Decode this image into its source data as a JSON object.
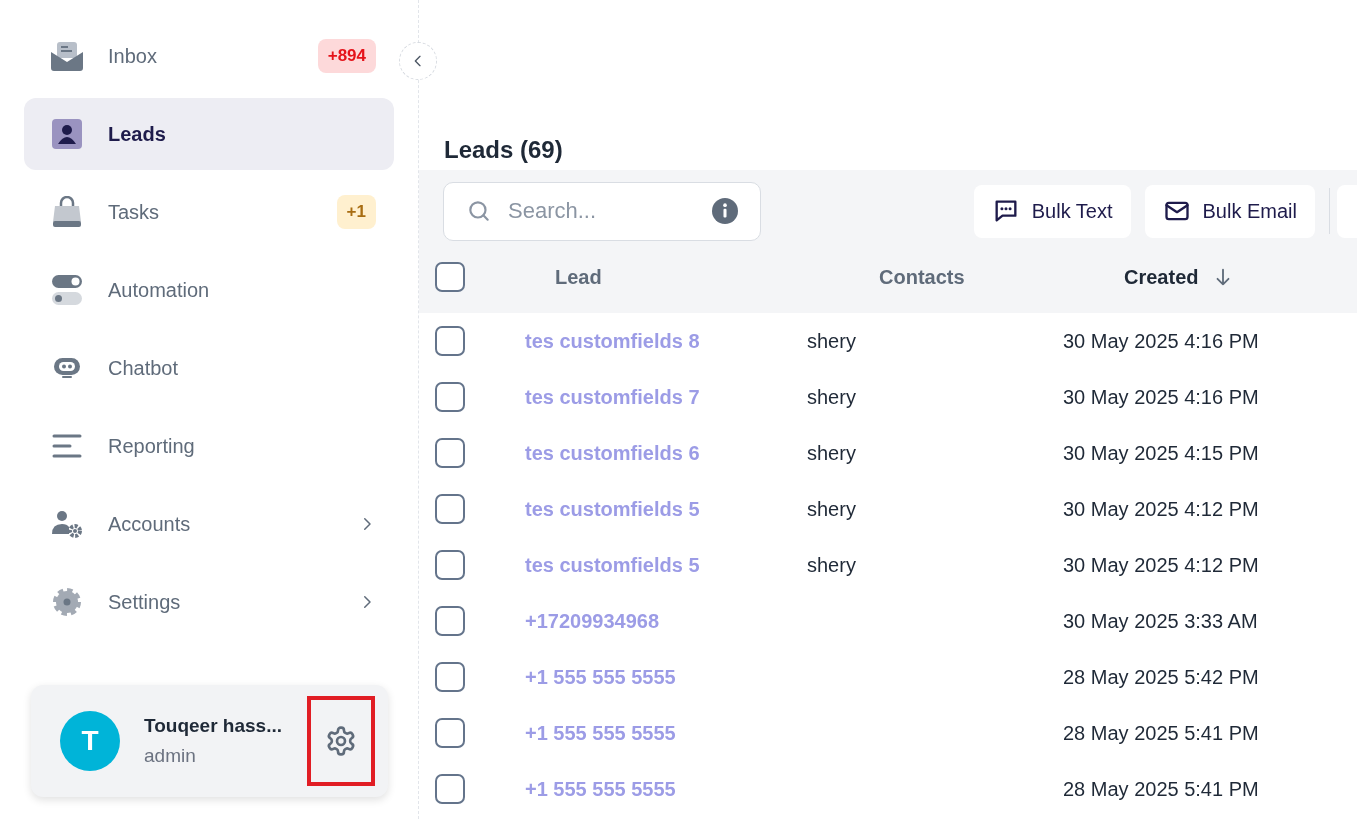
{
  "sidebar": {
    "items": [
      {
        "label": "Inbox",
        "kind": "inbox",
        "selected": false,
        "has_submenu": false,
        "badge": {
          "text": "+894",
          "kind": "danger"
        }
      },
      {
        "label": "Leads",
        "kind": "leads",
        "selected": true,
        "has_submenu": false
      },
      {
        "label": "Tasks",
        "kind": "tasks",
        "selected": false,
        "has_submenu": false,
        "badge": {
          "text": "+1",
          "kind": "warning"
        }
      },
      {
        "label": "Automation",
        "kind": "automation",
        "selected": false,
        "has_submenu": false
      },
      {
        "label": "Chatbot",
        "kind": "chatbot",
        "selected": false,
        "has_submenu": false
      },
      {
        "label": "Reporting",
        "kind": "reporting",
        "selected": false,
        "has_submenu": false
      },
      {
        "label": "Accounts",
        "kind": "accounts",
        "selected": false,
        "has_submenu": true
      },
      {
        "label": "Settings",
        "kind": "settings",
        "selected": false,
        "has_submenu": true
      }
    ],
    "profile": {
      "initial": "T",
      "name": "Touqeer hass...",
      "role": "admin",
      "settings_highlighted": true
    }
  },
  "page": {
    "title": "Leads (69)"
  },
  "toolbar": {
    "search": {
      "placeholder": "Search..."
    },
    "buttons": [
      {
        "label": "Bulk Text",
        "kind": "message"
      },
      {
        "label": "Bulk Email",
        "kind": "mail"
      }
    ]
  },
  "table": {
    "all_checked": false,
    "columns": [
      {
        "label": "Lead",
        "sorted": false
      },
      {
        "label": "Contacts",
        "sorted": false
      },
      {
        "label": "Created",
        "sorted": true
      }
    ],
    "rows": [
      {
        "lead": "tes customfields 8",
        "contacts": "shery",
        "created": "30 May 2025 4:16 PM",
        "checked": false
      },
      {
        "lead": "tes customfields 7",
        "contacts": "shery",
        "created": "30 May 2025 4:16 PM",
        "checked": false
      },
      {
        "lead": "tes customfields 6",
        "contacts": "shery",
        "created": "30 May 2025 4:15 PM",
        "checked": false
      },
      {
        "lead": "tes customfields 5",
        "contacts": "shery",
        "created": "30 May 2025 4:12 PM",
        "checked": false
      },
      {
        "lead": "tes customfields 5",
        "contacts": "shery",
        "created": "30 May 2025 4:12 PM",
        "checked": false
      },
      {
        "lead": "+17209934968",
        "created": "30 May 2025 3:33 AM",
        "checked": false
      },
      {
        "lead": "+1 555 555 5555",
        "created": "28 May 2025 5:42 PM",
        "checked": false
      },
      {
        "lead": "+1 555 555 5555",
        "created": "28 May 2025 5:41 PM",
        "checked": false
      },
      {
        "lead": "+1 555 555 5555",
        "created": "28 May 2025 5:41 PM",
        "checked": false
      }
    ]
  }
}
